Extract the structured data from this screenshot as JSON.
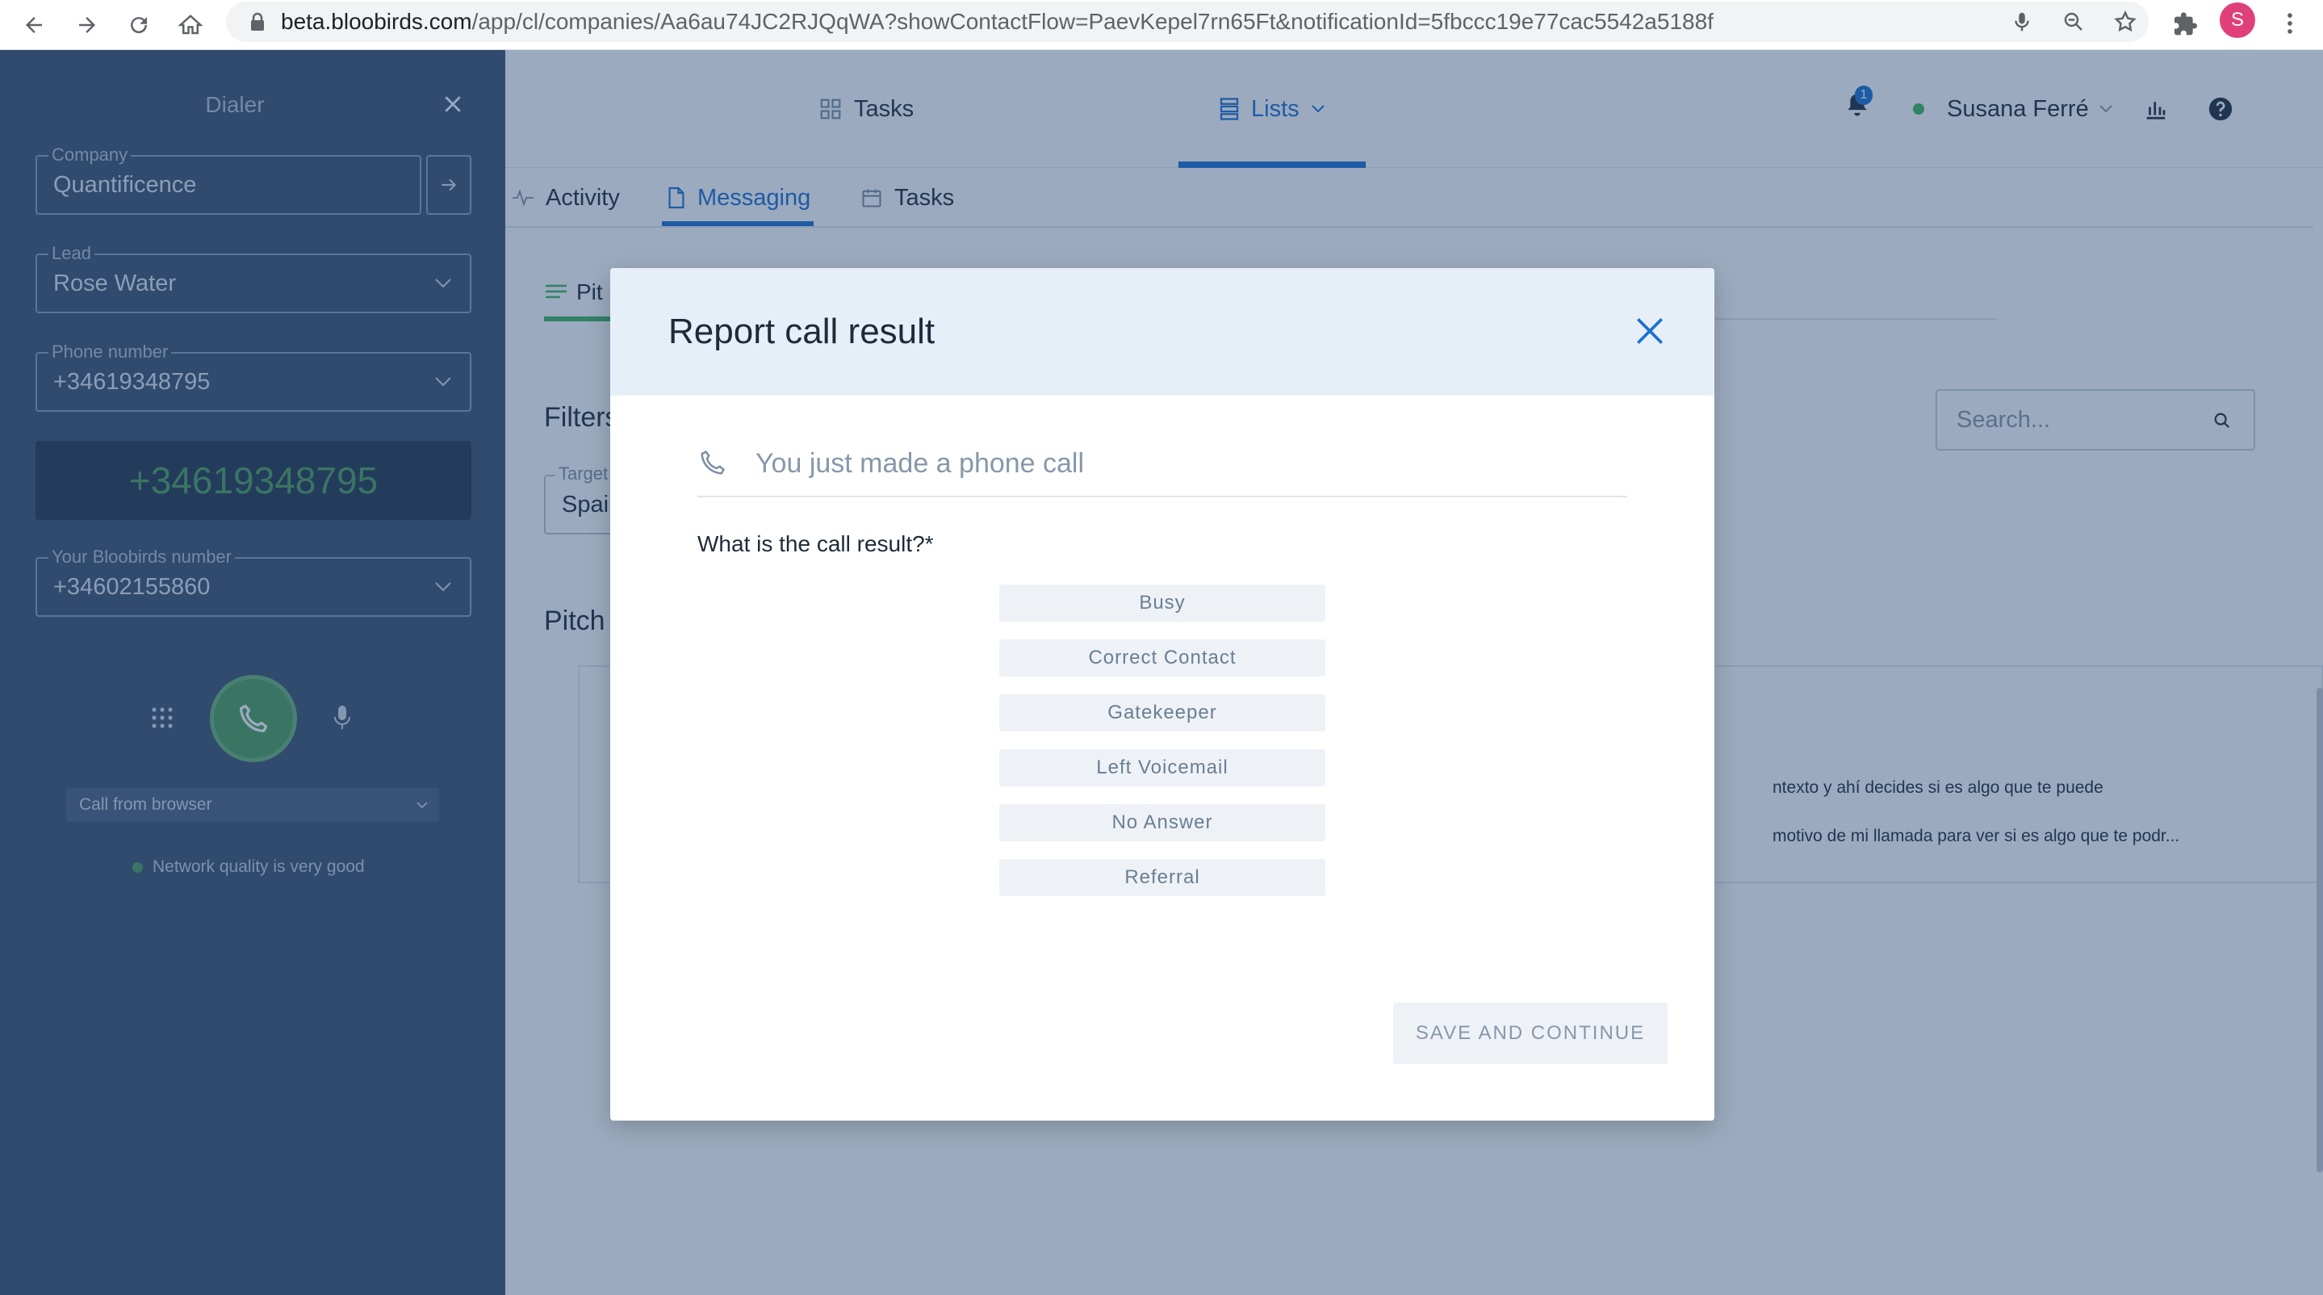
{
  "browser": {
    "url_host": "beta.bloobirds.com",
    "url_path": "/app/cl/companies/Aa6au74JC2RJQqWA?showContactFlow=PaevKepel7rn65Ft&notificationId=5fbccc19e77cac5542a5188f",
    "profile_initial": "S"
  },
  "dialer": {
    "title": "Dialer",
    "company": {
      "label": "Company",
      "value": "Quantificence"
    },
    "lead": {
      "label": "Lead",
      "value": "Rose Water"
    },
    "phone": {
      "label": "Phone number",
      "value": "+34619348795"
    },
    "display_number": "+34619348795",
    "bloobirds_number": {
      "label": "Your Bloobirds number",
      "value": "+34602155860"
    },
    "call_from": "Call from browser",
    "network_status": "Network quality is very good"
  },
  "topnav": {
    "tasks": "Tasks",
    "lists": "Lists",
    "notification_count": "1",
    "user_name": "Susana Ferré"
  },
  "subtabs": {
    "activity": "Activity",
    "messaging": "Messaging",
    "tasks": "Tasks"
  },
  "background": {
    "pitch_tab": "Pit",
    "filters": "Filters",
    "target_label": "Target",
    "target_value": "Spain",
    "pitch_heading": "Pitch",
    "search_placeholder": "Search...",
    "card_line_1": "ntexto y ahí decides si es algo que te puede",
    "card_line_2": "motivo de mi llamada para ver si es algo que te podr..."
  },
  "modal": {
    "title": "Report call result",
    "call_note": "You just made a phone call",
    "question": "What is the call result?*",
    "results": [
      "Busy",
      "Correct Contact",
      "Gatekeeper",
      "Left Voicemail",
      "No Answer",
      "Referral"
    ],
    "save_label": "SAVE AND CONTINUE"
  },
  "colors": {
    "dialer_bg": "#3c526e",
    "accent_blue": "#1d6fd1",
    "call_green": "#4f9e5c",
    "modal_header_bg": "#e6eef8"
  }
}
